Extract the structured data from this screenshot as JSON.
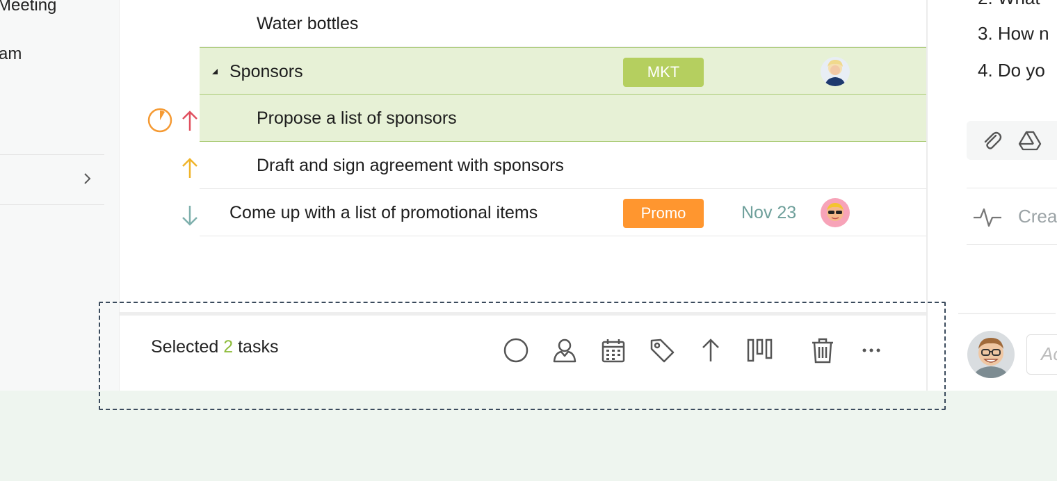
{
  "sidebar": {
    "items": [
      {
        "label": "Meeting"
      },
      {
        "label": "am"
      }
    ]
  },
  "tasks": {
    "rows": [
      {
        "title": "Water bottles",
        "tag": "",
        "due": ""
      },
      {
        "title": "Sponsors",
        "tag": "MKT",
        "due": ""
      },
      {
        "title": "Propose a list of sponsors",
        "tag": "",
        "due": ""
      },
      {
        "title": "Draft and sign agreement with sponsors",
        "tag": "",
        "due": ""
      },
      {
        "title": "Come up with a list of promotional items",
        "tag": "Promo",
        "due": "Nov 23"
      }
    ]
  },
  "selection_bar": {
    "prefix": "Selected",
    "count": "2",
    "suffix": "tasks"
  },
  "toolbar_icons": [
    "status-circle-icon",
    "assignee-icon",
    "calendar-icon",
    "tag-icon",
    "priority-up-icon",
    "board-columns-icon",
    "trash-icon",
    "more-icon"
  ],
  "right_panel": {
    "questions": [
      "2. What",
      "3. How n",
      "4. Do yo"
    ],
    "activity_placeholder": "Crea",
    "comment_placeholder": "Ac"
  },
  "colors": {
    "accent_green": "#8ebc3b",
    "highlight_row": "#e7f1d6",
    "tag_mkt": "#b5cf5f",
    "tag_promo": "#ff962f",
    "due_date": "#6fa09b",
    "priority_high": "#e0505f",
    "priority_medium": "#f0b429",
    "priority_low": "#7fb0ad"
  }
}
